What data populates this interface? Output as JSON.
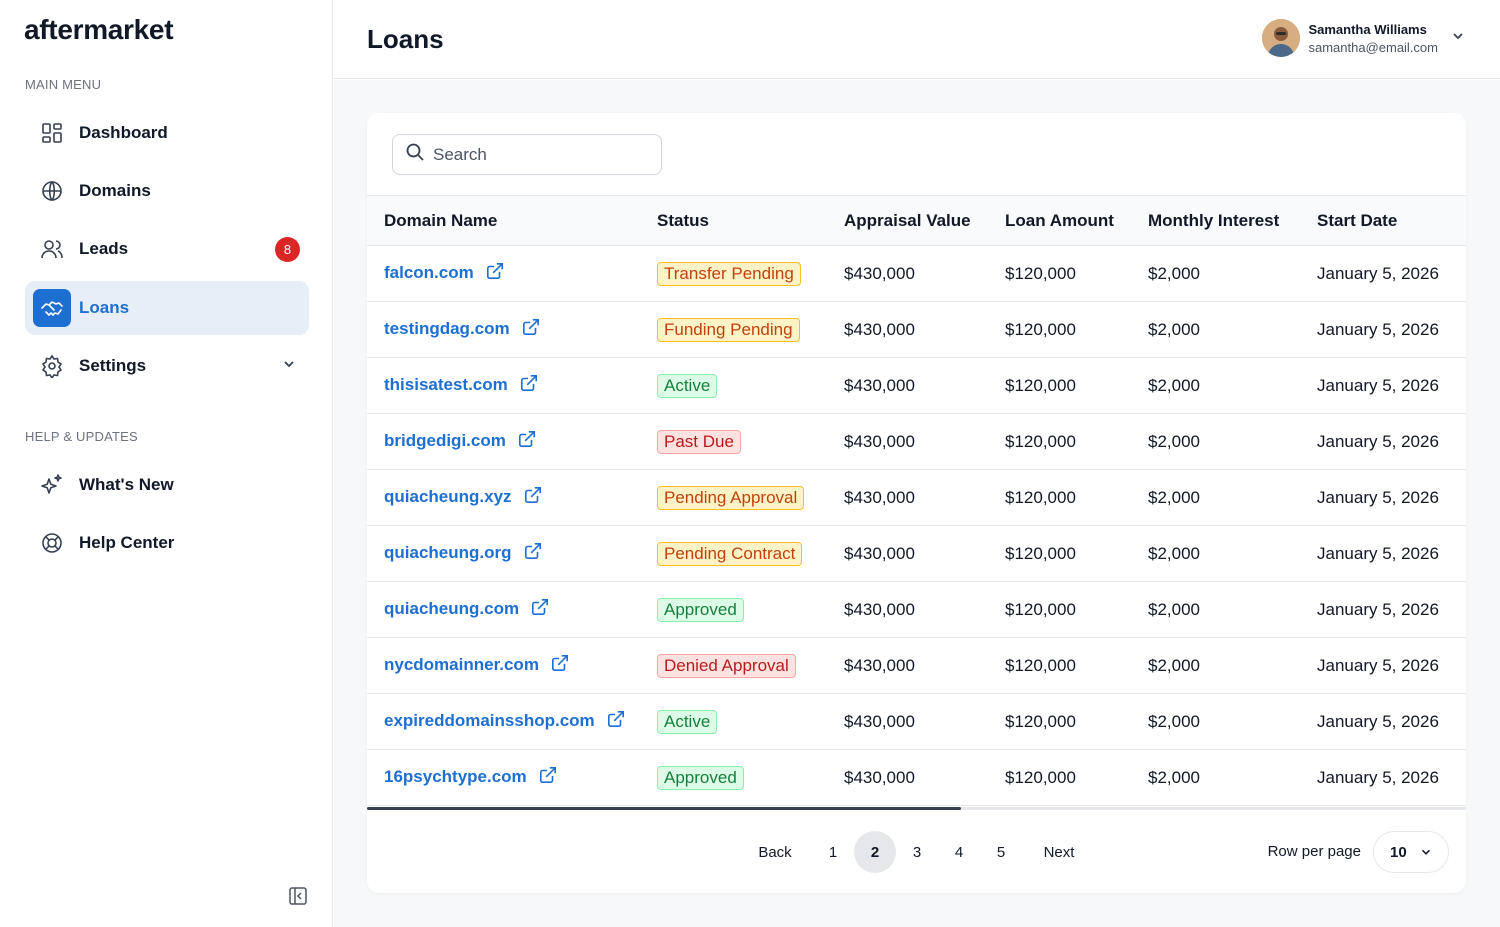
{
  "app": {
    "logo": "aftermarket"
  },
  "sidebar": {
    "main_menu_label": "MAIN MENU",
    "help_label": "HELP & UPDATES",
    "items": [
      {
        "label": "Dashboard",
        "icon": "dashboard-icon"
      },
      {
        "label": "Domains",
        "icon": "globe-icon"
      },
      {
        "label": "Leads",
        "icon": "users-icon",
        "badge": "8"
      },
      {
        "label": "Loans",
        "icon": "handshake-icon",
        "active": true
      },
      {
        "label": "Settings",
        "icon": "gear-icon"
      }
    ],
    "help_items": [
      {
        "label": "What's New",
        "icon": "sparkles-icon"
      },
      {
        "label": "Help Center",
        "icon": "lifebuoy-icon"
      }
    ]
  },
  "header": {
    "title": "Loans",
    "user": {
      "name": "Samantha Williams",
      "email": "samantha@email.com"
    }
  },
  "search": {
    "placeholder": "Search"
  },
  "table": {
    "columns": [
      "Domain Name",
      "Status",
      "Appraisal Value",
      "Loan Amount",
      "Monthly Interest",
      "Start Date"
    ],
    "rows": [
      {
        "domain": "falcon.com",
        "status": "Transfer Pending",
        "tone": "orange",
        "appraisal": "$430,000",
        "loan": "$120,000",
        "interest": "$2,000",
        "start": "January 5, 2026"
      },
      {
        "domain": "testingdag.com",
        "status": "Funding Pending",
        "tone": "orange",
        "appraisal": "$430,000",
        "loan": "$120,000",
        "interest": "$2,000",
        "start": "January 5, 2026"
      },
      {
        "domain": "thisisatest.com",
        "status": "Active",
        "tone": "green",
        "appraisal": "$430,000",
        "loan": "$120,000",
        "interest": "$2,000",
        "start": "January 5, 2026"
      },
      {
        "domain": "bridgedigi.com",
        "status": "Past Due",
        "tone": "red",
        "appraisal": "$430,000",
        "loan": "$120,000",
        "interest": "$2,000",
        "start": "January 5, 2026"
      },
      {
        "domain": "quiacheung.xyz",
        "status": "Pending Approval",
        "tone": "orange",
        "appraisal": "$430,000",
        "loan": "$120,000",
        "interest": "$2,000",
        "start": "January 5, 2026"
      },
      {
        "domain": "quiacheung.org",
        "status": "Pending Contract",
        "tone": "orange",
        "appraisal": "$430,000",
        "loan": "$120,000",
        "interest": "$2,000",
        "start": "January 5, 2026"
      },
      {
        "domain": "quiacheung.com",
        "status": "Approved",
        "tone": "green",
        "appraisal": "$430,000",
        "loan": "$120,000",
        "interest": "$2,000",
        "start": "January 5, 2026"
      },
      {
        "domain": "nycdomainner.com",
        "status": "Denied Approval",
        "tone": "red",
        "appraisal": "$430,000",
        "loan": "$120,000",
        "interest": "$2,000",
        "start": "January 5, 2026"
      },
      {
        "domain": "expireddomainsshop.com",
        "status": "Active",
        "tone": "green",
        "appraisal": "$430,000",
        "loan": "$120,000",
        "interest": "$2,000",
        "start": "January 5, 2026"
      },
      {
        "domain": "16psychtype.com",
        "status": "Approved",
        "tone": "green",
        "appraisal": "$430,000",
        "loan": "$120,000",
        "interest": "$2,000",
        "start": "January 5, 2026"
      }
    ]
  },
  "pagination": {
    "back": "Back",
    "next": "Next",
    "pages": [
      "1",
      "2",
      "3",
      "4",
      "5"
    ],
    "current": "2",
    "rows_label": "Row per page",
    "rows_value": "10"
  },
  "colors": {
    "accent": "#1d6fd1",
    "badge": "#dc2626",
    "status_orange": "#c2410c",
    "status_green": "#15803d",
    "status_red": "#b91c1c"
  }
}
